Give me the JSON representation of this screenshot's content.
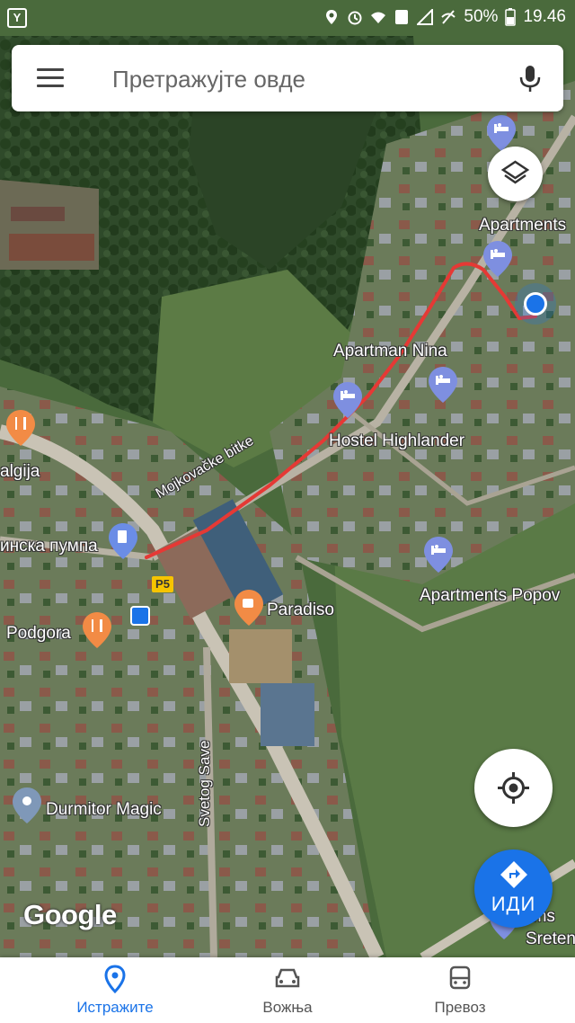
{
  "status_bar": {
    "left_icon": "Y",
    "icons": [
      "location-icon",
      "alarm-icon",
      "wifi-icon",
      "data-icon",
      "signal-icon",
      "mute-icon"
    ],
    "battery": "50%",
    "time": "19.46"
  },
  "search": {
    "placeholder": "Претражујте овде"
  },
  "map": {
    "roads": {
      "mojkovacke": "Mojkovačke bitke",
      "svetog_save": "Svetog Save",
      "route_badge": "P5"
    },
    "places": [
      {
        "name": "Apartments",
        "kind": "hotel"
      },
      {
        "name": "Apartman Nina",
        "kind": "hotel"
      },
      {
        "name": "Hostel Highlander",
        "kind": "hotel"
      },
      {
        "name": "Apartments Popov",
        "kind": "hotel"
      },
      {
        "name": "Paradiso",
        "kind": "cafe"
      },
      {
        "name": "Podgora",
        "kind": "restaurant"
      },
      {
        "name": "algija",
        "kind": "restaurant"
      },
      {
        "name": "инска пумпа",
        "kind": "gas-station"
      },
      {
        "name": "Durmitor Magic",
        "kind": "place"
      },
      {
        "name": "oms",
        "kind": "hotel"
      },
      {
        "name": "Sreten",
        "kind": "place"
      }
    ],
    "attribution": "Google",
    "accent_route": "#e53935",
    "accent_blue": "#1a73e8"
  },
  "go_button": {
    "label": "ИДИ"
  },
  "bottom_nav": [
    {
      "label": "Истражите",
      "icon": "location-pin-icon",
      "active": true
    },
    {
      "label": "Вожња",
      "icon": "car-icon",
      "active": false
    },
    {
      "label": "Превоз",
      "icon": "bus-icon",
      "active": false
    }
  ]
}
